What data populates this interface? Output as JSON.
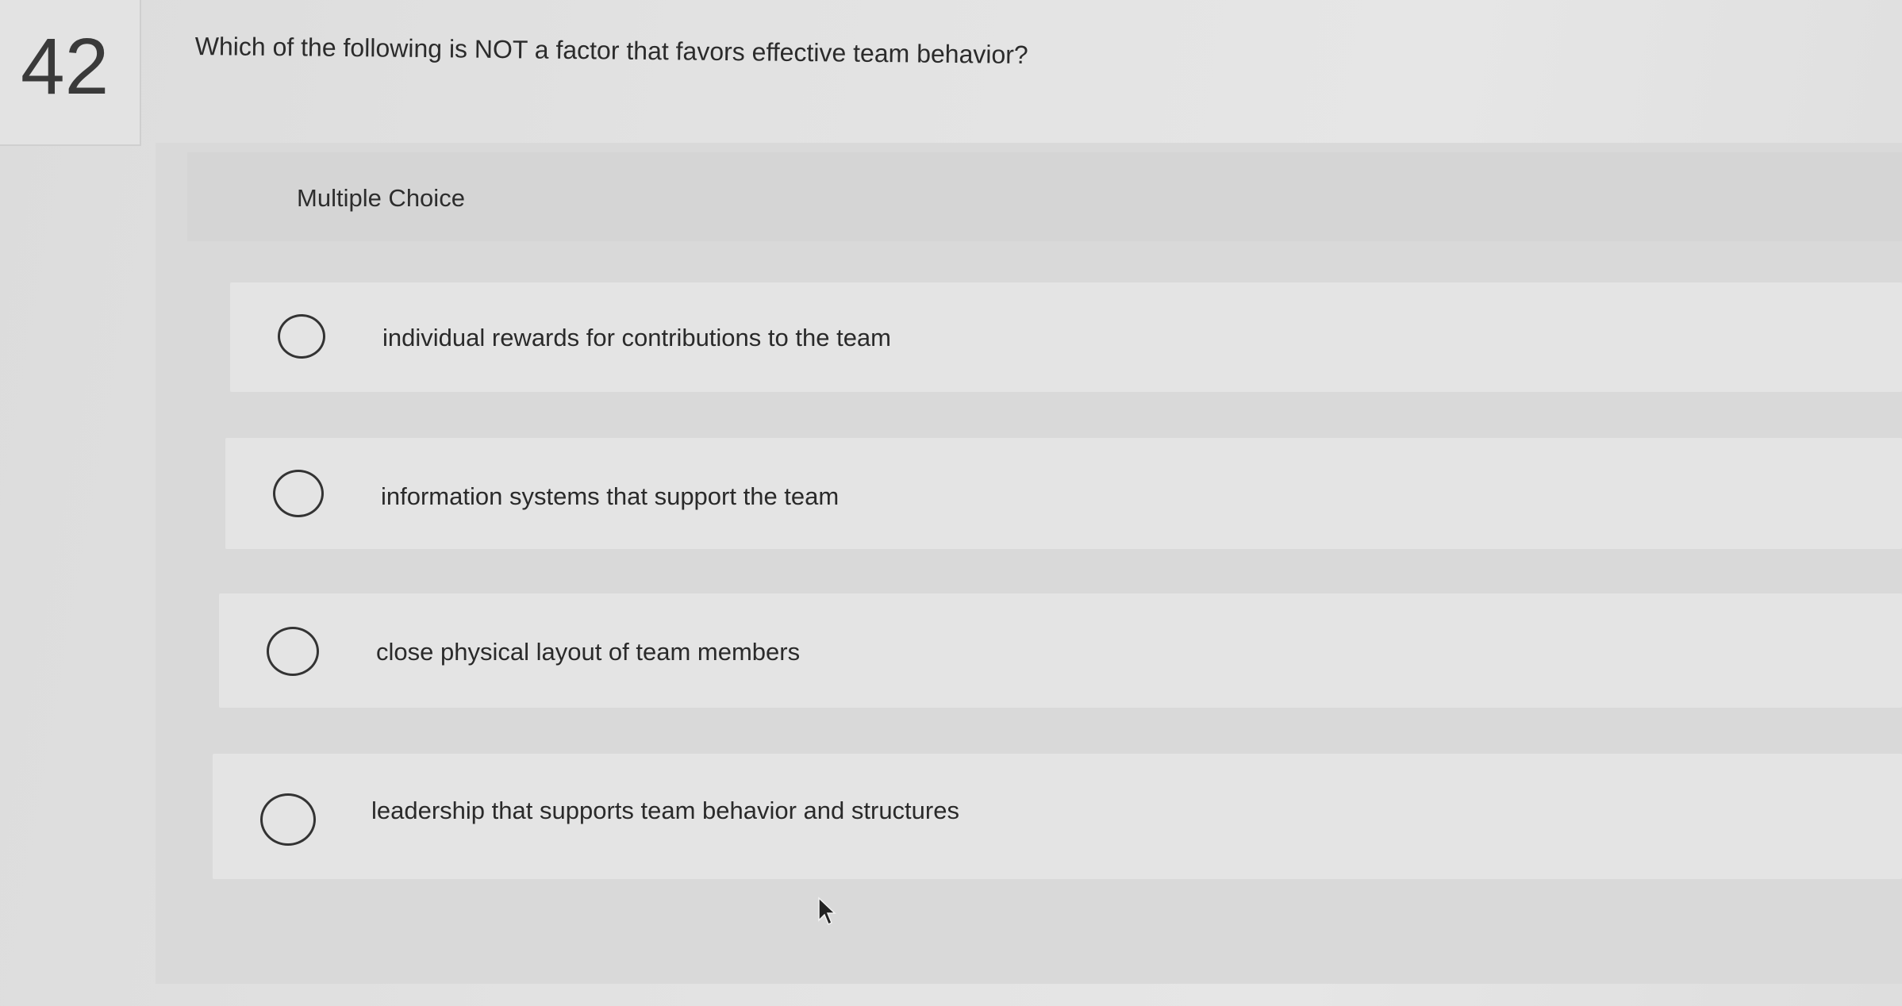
{
  "question": {
    "number": "42",
    "text": "Which of the following is NOT a factor that favors effective team behavior?"
  },
  "answer_block": {
    "type_label": "Multiple Choice",
    "options": [
      {
        "label": "individual rewards for contributions to the team",
        "selected": false
      },
      {
        "label": "information systems that support the team",
        "selected": false
      },
      {
        "label": "close physical layout of team members",
        "selected": false
      },
      {
        "label": "leadership that supports team behavior and structures",
        "selected": false
      }
    ]
  },
  "icons": {
    "radio": "radio-button-empty-icon",
    "cursor": "mouse-pointer-icon"
  },
  "colors": {
    "background": "#e2e2e2",
    "option_background": "#e4e4e4",
    "text": "#2a2a2a"
  }
}
